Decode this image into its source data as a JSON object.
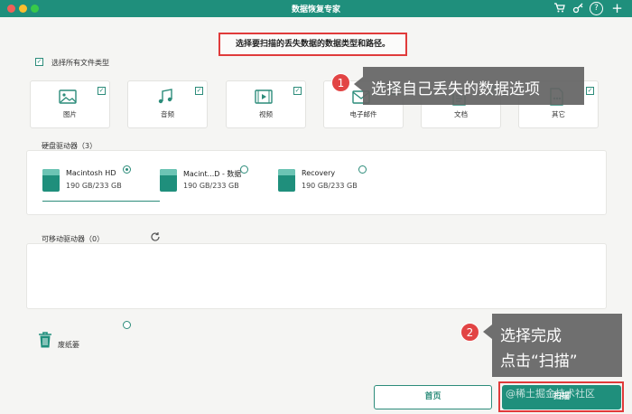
{
  "window": {
    "title": "数据恢复专家",
    "traffic_colors": [
      "#f25f58",
      "#fbbe2e",
      "#38c94a"
    ]
  },
  "toolbar": {
    "cart_icon": "cart-icon",
    "key_icon": "key-icon",
    "help_label": "?",
    "add_label": "+"
  },
  "instruction": "选择要扫描的丢失数据的数据类型和路径。",
  "select_all": {
    "label": "选择所有文件类型",
    "checked": true
  },
  "file_types": [
    {
      "label": "图片",
      "icon": "image-icon",
      "checked": true
    },
    {
      "label": "音频",
      "icon": "music-icon",
      "checked": true
    },
    {
      "label": "视频",
      "icon": "video-icon",
      "checked": true
    },
    {
      "label": "电子邮件",
      "icon": "email-icon",
      "checked": true
    },
    {
      "label": "文档",
      "icon": "document-icon",
      "checked": true
    },
    {
      "label": "其它",
      "icon": "other-icon",
      "checked": true
    }
  ],
  "hard_drives": {
    "title": "硬盘驱动器（3）",
    "items": [
      {
        "name": "Macintosh HD",
        "size": "190 GB/233 GB",
        "selected": true
      },
      {
        "name": "Macint...D - 数据",
        "size": "190 GB/233 GB",
        "selected": false
      },
      {
        "name": "Recovery",
        "size": "190 GB/233 GB",
        "selected": false
      }
    ]
  },
  "removable": {
    "title": "可移动驱动器（0）",
    "refresh_icon": "refresh-icon"
  },
  "trash": {
    "label": "废纸篓",
    "selected": false
  },
  "callouts": {
    "step1_number": "1",
    "step1_text": "选择自己丢失的数据选项",
    "step2_number": "2",
    "step2_line1": "选择完成",
    "step2_line2": "点击“扫描”"
  },
  "buttons": {
    "home": "首页",
    "scan": "扫描"
  },
  "watermark": "@稀土掘金技术社区",
  "colors": {
    "accent": "#1f8f7c",
    "highlight": "#e03b3b",
    "callout_bg": "#646464"
  }
}
